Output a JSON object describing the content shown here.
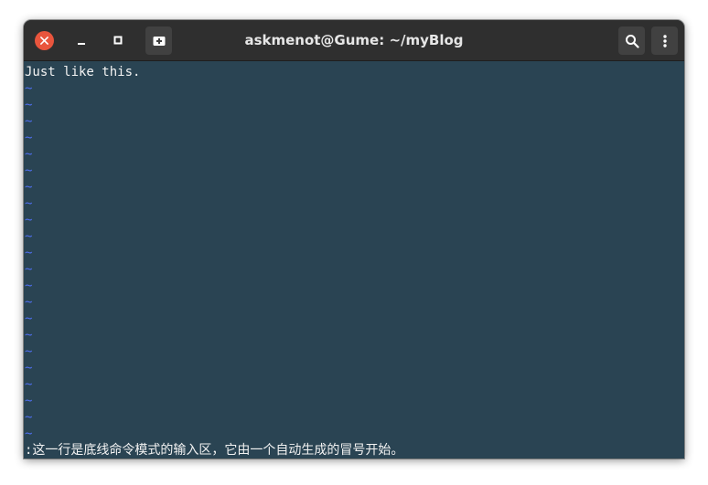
{
  "window": {
    "title": "askmenot@Gume: ~/myBlog"
  },
  "titlebar": {
    "buttons": [
      {
        "name": "close",
        "icon": "close-icon"
      },
      {
        "name": "minimize",
        "icon": "minimize-icon"
      },
      {
        "name": "maximize",
        "icon": "maximize-icon"
      },
      {
        "name": "new-tab",
        "icon": "new-tab-icon"
      },
      {
        "name": "search",
        "icon": "search-icon"
      },
      {
        "name": "menu",
        "icon": "kebab-menu-icon"
      }
    ]
  },
  "terminal": {
    "first_line": "Just like this.",
    "empty_line_marker": "~",
    "empty_line_count": 22,
    "command_line": ":这一行是底线命令模式的输入区，它由一个自动生成的冒号开始。"
  },
  "colors": {
    "terminal_background": "#2a4453",
    "titlebar_background": "#2f2f2f",
    "text": "#f2f2f2",
    "tilde": "#4f6ff0",
    "close_button": "#e9553d"
  }
}
